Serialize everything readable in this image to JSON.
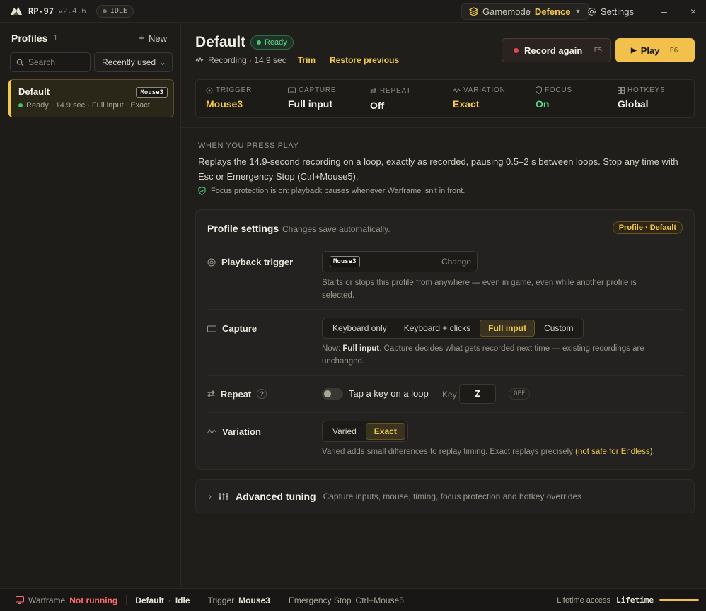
{
  "app": {
    "name": "RP-97",
    "version": "v2.4.6",
    "status": "IDLE"
  },
  "titlebar": {
    "gamemode_label": "Gamemode",
    "gamemode_value": "Defence",
    "settings_label": "Settings",
    "minimize": "–",
    "close": "×"
  },
  "sidebar": {
    "title": "Profiles",
    "count": "1",
    "new_label": "New",
    "search_placeholder": "Search",
    "sort_value": "Recently used",
    "profiles": [
      {
        "name": "Default",
        "key": "Mouse3",
        "meta": "Ready · 14.9 sec · Full input · Exact"
      }
    ]
  },
  "header": {
    "title": "Default",
    "status": "Ready",
    "recording": "Recording · 14.9 sec",
    "trim": "Trim",
    "restore": "Restore previous",
    "record_again": "Record again",
    "record_key": "F5",
    "play": "Play",
    "play_key": "F6"
  },
  "stats": [
    {
      "label": "TRIGGER",
      "value": "Mouse3",
      "color": "#f2c94c"
    },
    {
      "label": "CAPTURE",
      "value": "Full input",
      "color": "#f2efe6"
    },
    {
      "label": "REPEAT",
      "value": "Off",
      "color": "#f2efe6"
    },
    {
      "label": "VARIATION",
      "value": "Exact",
      "color": "#f2c94c"
    },
    {
      "label": "FOCUS",
      "value": "On",
      "color": "#5ed68a"
    },
    {
      "label": "HOTKEYS",
      "value": "Global",
      "color": "#f2efe6"
    }
  ],
  "when": {
    "heading": "WHEN YOU PRESS PLAY",
    "desc": "Replays the 14.9-second recording on a loop, exactly as recorded, pausing 0.5–2 s between loops. Stop any time with Esc or Emergency Stop (Ctrl+Mouse5).",
    "focus_note": "Focus protection is on: playback pauses whenever Warframe isn't in front."
  },
  "profile_settings": {
    "title": "Profile settings",
    "subtitle": "Changes save automatically.",
    "badge": "Profile · Default",
    "trigger": {
      "label": "Playback trigger",
      "key": "Mouse3",
      "change": "Change",
      "help": "Starts or stops this profile from anywhere — even in game, even while another profile is selected."
    },
    "capture": {
      "label": "Capture",
      "options": [
        "Keyboard only",
        "Keyboard + clicks",
        "Full input",
        "Custom"
      ],
      "selected": "Full input",
      "help_prefix": "Now: ",
      "help_value": "Full input",
      "help_suffix": ". Capture decides what gets recorded next time — existing recordings are unchanged."
    },
    "repeat": {
      "label": "Repeat",
      "help_icon": "?",
      "toggle_label": "Tap a key on a loop",
      "key_label": "Key",
      "key_value": "Z",
      "state": "OFF"
    },
    "variation": {
      "label": "Variation",
      "options": [
        "Varied",
        "Exact"
      ],
      "selected": "Exact",
      "help": "Varied adds small differences to replay timing. Exact replays precisely ",
      "help_warn": "(not safe for Endless)",
      "help_end": "."
    }
  },
  "advanced": {
    "title": "Advanced tuning",
    "subtitle": "Capture inputs, mouse, timing, focus protection and hotkey overrides"
  },
  "footer": {
    "game": "Warframe",
    "game_status": "Not running",
    "profile": "Default",
    "profile_state": "Idle",
    "trigger_label": "Trigger",
    "trigger_value": "Mouse3",
    "estop_label": "Emergency Stop",
    "estop_value": "Ctrl+Mouse5",
    "access_label": "Lifetime access",
    "access_value": "Lifetime"
  }
}
